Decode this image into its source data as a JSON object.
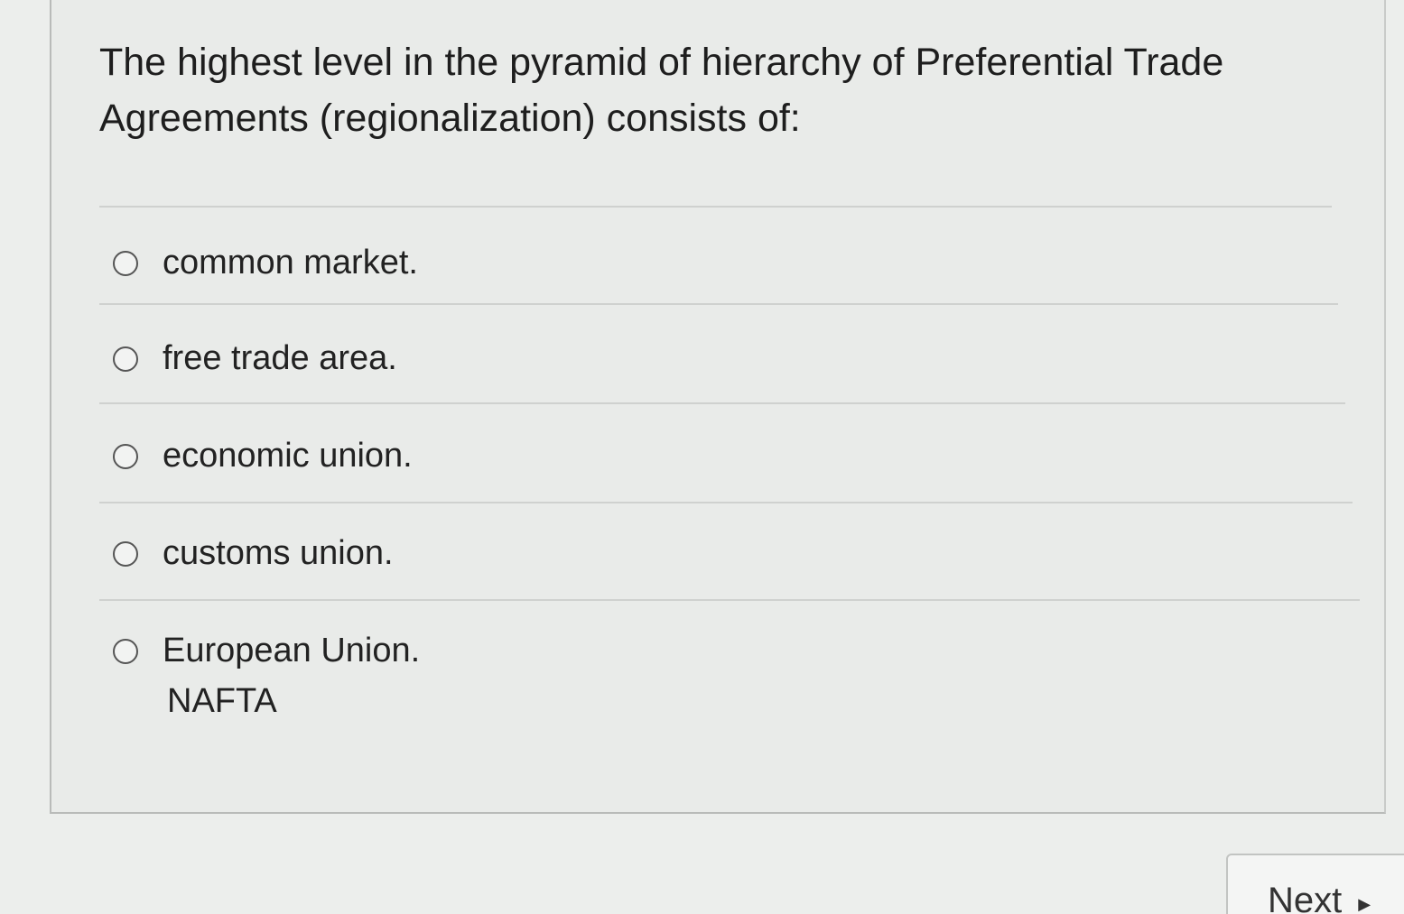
{
  "question": {
    "text": "The highest level in the pyramid of hierarchy of Preferential Trade Agreements (regionalization) consists of:"
  },
  "options": [
    {
      "label": "common market."
    },
    {
      "label": "free trade area."
    },
    {
      "label": "economic union."
    },
    {
      "label": "customs union."
    },
    {
      "label": "European Union."
    }
  ],
  "note": "NAFTA",
  "navigation": {
    "next_label": "Next",
    "next_icon": "caret-right-icon"
  }
}
